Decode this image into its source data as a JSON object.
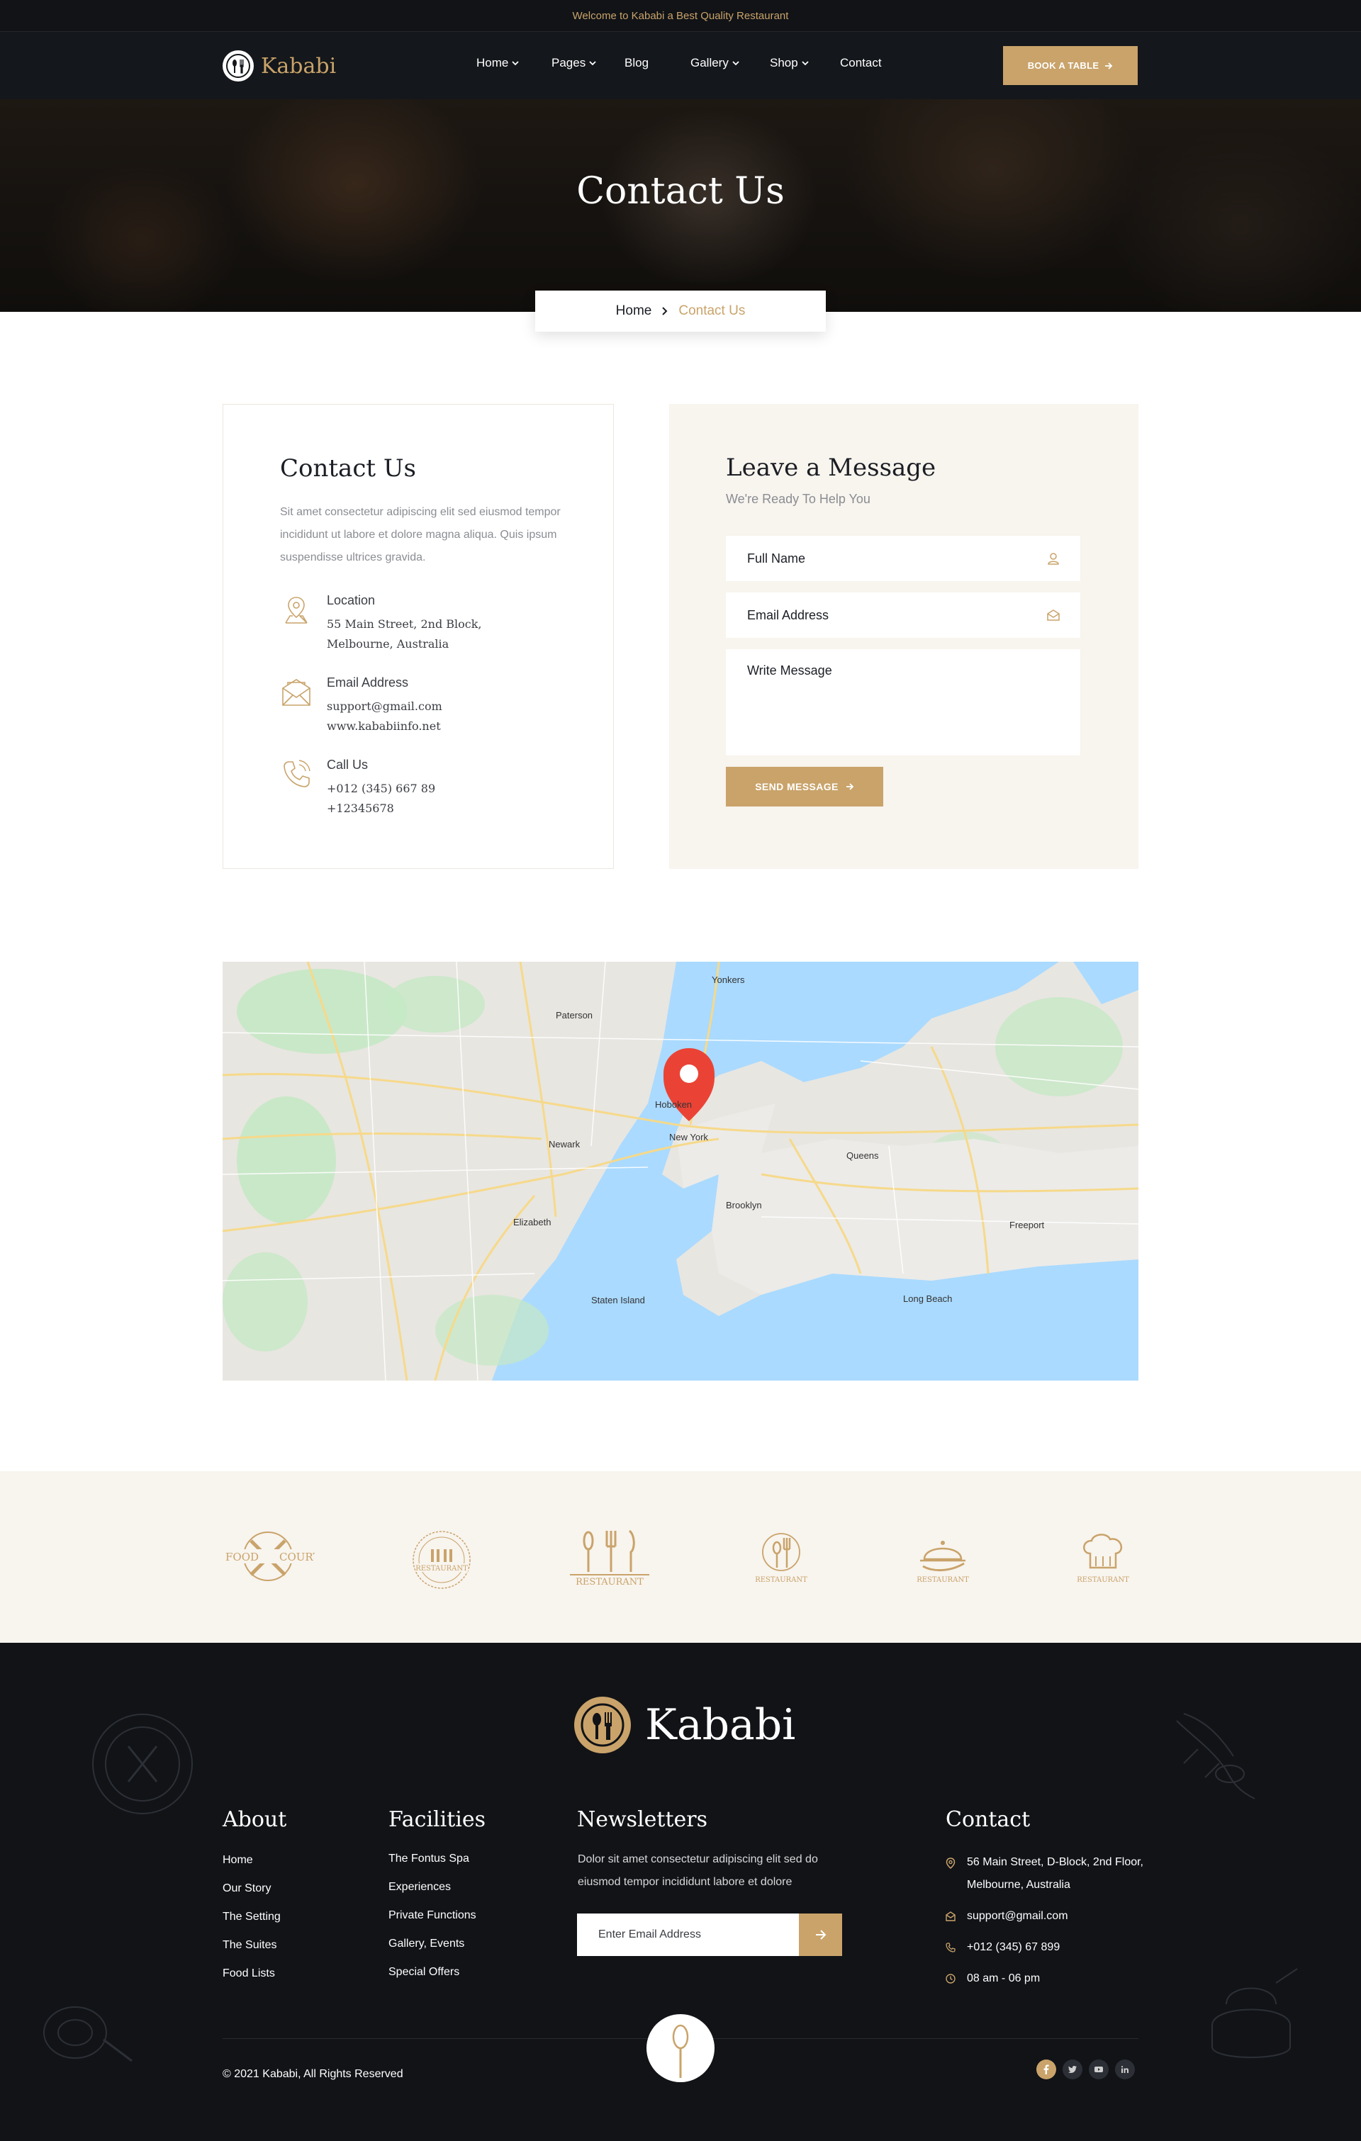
{
  "topbar": {
    "text": "Welcome to Kababi a Best Quality Restaurant"
  },
  "header": {
    "logo_text": "Kababi",
    "nav": [
      {
        "label": "Home",
        "dropdown": true
      },
      {
        "label": "Pages",
        "dropdown": true
      },
      {
        "label": "Blog",
        "dropdown": false
      },
      {
        "label": "Gallery",
        "dropdown": true
      },
      {
        "label": "Shop",
        "dropdown": true
      },
      {
        "label": "Contact",
        "dropdown": false
      }
    ],
    "book_button": "BOOK A TABLE"
  },
  "hero": {
    "title": "Contact Us",
    "breadcrumb_home": "Home",
    "breadcrumb_current": "Contact Us"
  },
  "contact_info": {
    "title": "Contact Us",
    "description": "Sit amet consectetur adipiscing elit sed eiusmod tempor incididunt ut labore et dolore magna aliqua. Quis ipsum suspendisse ultrices gravida.",
    "location_label": "Location",
    "location_line1": "55 Main Street, 2nd Block,",
    "location_line2": "Melbourne, Australia",
    "email_label": "Email Address",
    "email_line1": "support@gmail.com",
    "email_line2": "www.kababiinfo.net",
    "phone_label": "Call Us",
    "phone_line1": "+012 (345) 667 89",
    "phone_line2": "+12345678"
  },
  "message_form": {
    "title": "Leave a Message",
    "subtitle": "We're Ready To Help You",
    "name_placeholder": "Full Name",
    "email_placeholder": "Email Address",
    "message_placeholder": "Write Message",
    "send_button": "SEND MESSAGE"
  },
  "map": {
    "pin_label": "New York",
    "places": [
      "Newark",
      "Brooklyn",
      "Queens",
      "Elizabeth",
      "Hoboken",
      "Paterson",
      "Yonkers",
      "Staten Island",
      "Long Beach",
      "Freeport"
    ]
  },
  "brands": [
    {
      "name": "Food Court",
      "line1": "FOOD",
      "line2": "COURT"
    },
    {
      "name": "Restaurant Badge",
      "line1": "RESTAURANT",
      "line2": ""
    },
    {
      "name": "Restaurant Cutlery",
      "line1": "RESTAURANT",
      "line2": ""
    },
    {
      "name": "Restaurant Spoon",
      "line1": "RESTAURANT",
      "line2": ""
    },
    {
      "name": "Restaurant Cloche",
      "line1": "RESTAURANT",
      "line2": ""
    },
    {
      "name": "Restaurant Chef",
      "line1": "RESTAURANT",
      "line2": ""
    }
  ],
  "footer": {
    "logo_text": "Kababi",
    "about_title": "About",
    "about_links": [
      "Home",
      "Our Story",
      "The Setting",
      "The Suites",
      "Food Lists"
    ],
    "facilities_title": "Facilities",
    "facilities_links": [
      "The Fontus Spa",
      "Experiences",
      "Private Functions",
      "Gallery, Events",
      "Special Offers"
    ],
    "newsletter_title": "Newsletters",
    "newsletter_text": "Dolor sit amet consectetur adipiscing elit sed do eiusmod tempor incididunt labore et dolore",
    "newsletter_placeholder": "Enter Email Address",
    "contact_title": "Contact",
    "contact_address_line1": "56 Main Street, D-Block, 2nd Floor,",
    "contact_address_line2": "Melbourne, Australia",
    "contact_email": "support@gmail.com",
    "contact_phone": "+012 (345) 67 899",
    "contact_hours": "08 am - 06 pm",
    "copyright": "© 2021 Kababi, All Rights Reserved",
    "socials": [
      "facebook-icon",
      "twitter-icon",
      "youtube-icon",
      "linkedin-icon"
    ]
  },
  "colors": {
    "accent": "#c9a36a",
    "dark": "#111317",
    "cream": "#f8f4ee"
  }
}
